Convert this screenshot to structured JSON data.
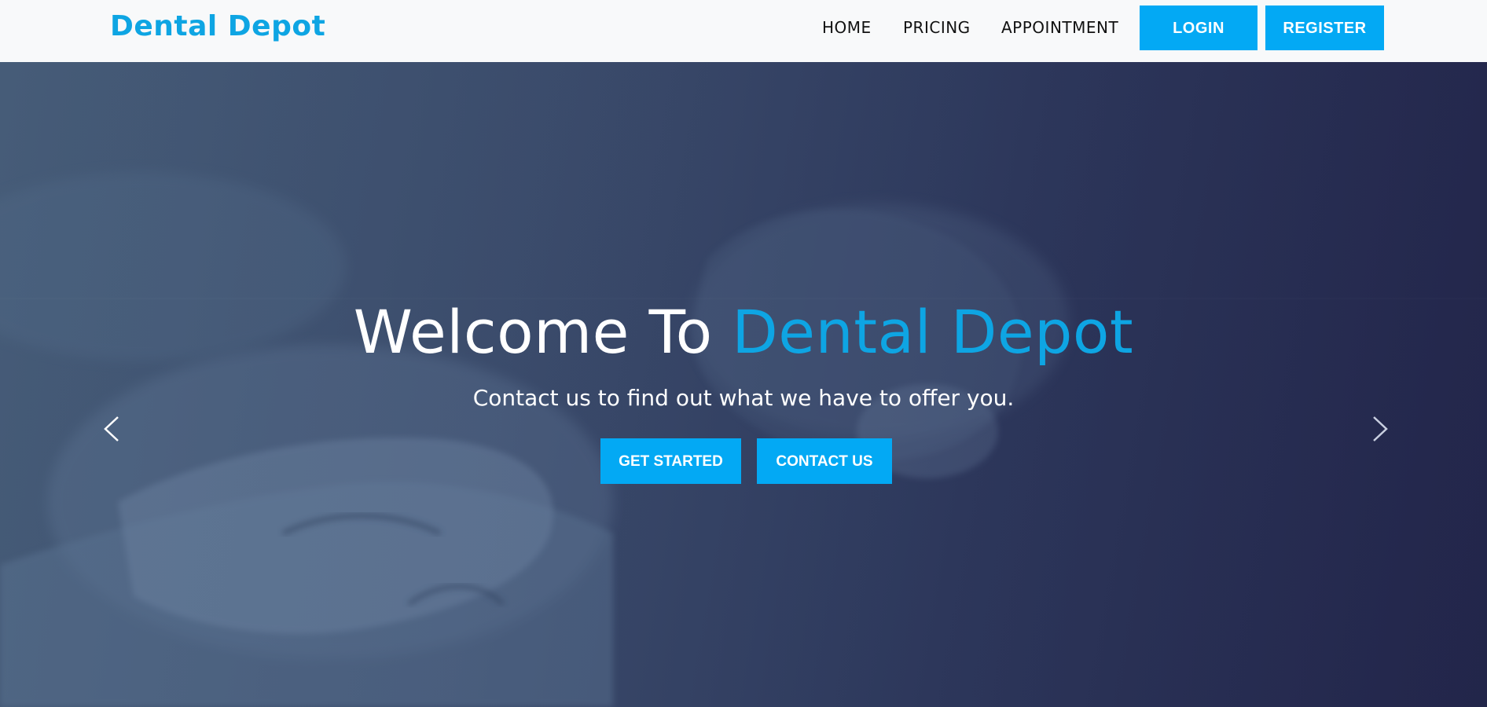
{
  "navbar": {
    "brand": "Dental Depot",
    "links": [
      {
        "label": "HOME"
      },
      {
        "label": "PRICING"
      },
      {
        "label": "APPOINTMENT"
      }
    ],
    "login_label": "LOGIN",
    "register_label": "REGISTER"
  },
  "hero": {
    "title_prefix": "Welcome To ",
    "title_accent": "Dental Depot",
    "subtitle": "Contact us to find out what we have to offer you.",
    "get_started_label": "GET STARTED",
    "contact_label": "CONTACT US",
    "prev_icon": "chevron-left-icon",
    "next_icon": "chevron-right-icon"
  },
  "colors": {
    "accent": "#03a9f4",
    "brand_text": "#0ea5e3",
    "navbar_bg": "#f8f9fa",
    "hero_dark": "#262a4e",
    "hero_light": "#465c78"
  }
}
